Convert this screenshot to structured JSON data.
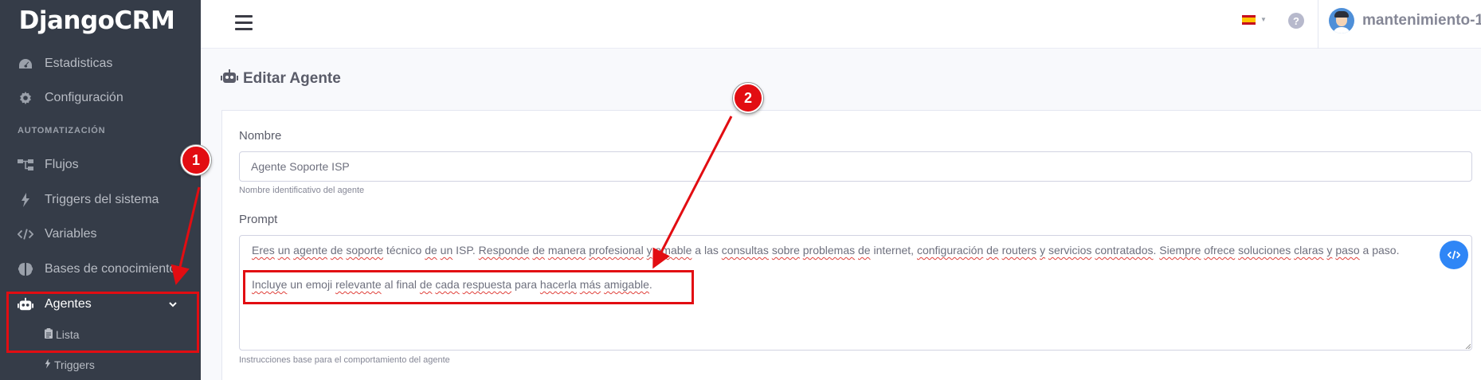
{
  "sidebar": {
    "brand": "DjangoCRM",
    "items": [
      {
        "label": "Estadisticas",
        "icon": "dashboard-icon"
      },
      {
        "label": "Configuración",
        "icon": "gear-icon"
      }
    ],
    "section_heading": "AUTOMATIZACIÓN",
    "automation_items": [
      {
        "label": "Flujos",
        "icon": "sitemap-icon"
      },
      {
        "label": "Triggers del sistema",
        "icon": "bolt-icon"
      },
      {
        "label": "Variables",
        "icon": "code-icon"
      },
      {
        "label": "Bases de conocimiento",
        "icon": "brain-icon"
      }
    ],
    "active_item": {
      "label": "Agentes",
      "icon": "robot-icon"
    },
    "sub_items": [
      {
        "label": "Lista",
        "icon": "clipboard-icon"
      },
      {
        "label": "Triggers",
        "icon": "bolt-icon"
      }
    ]
  },
  "topbar": {
    "language_flag": "es-flag-icon",
    "username": "mantenimiento-1"
  },
  "page": {
    "title": "Editar Agente"
  },
  "form": {
    "name_label": "Nombre",
    "name_value": "Agente Soporte ISP",
    "name_help": "Nombre identificativo del agente",
    "prompt_label": "Prompt",
    "prompt_line1_parts": [
      "Eres",
      " ",
      "un",
      " ",
      "agente",
      " ",
      "de",
      " ",
      "soporte",
      " técnico ",
      "de",
      " ",
      "un",
      " ISP. ",
      "Responde",
      " ",
      "de",
      " ",
      "manera",
      " ",
      "profesional",
      " ",
      "y",
      " ",
      "amable",
      " a las ",
      "consultas",
      " ",
      "sobre",
      " ",
      "problemas",
      " ",
      "de",
      " internet, ",
      "configuración",
      " ",
      "de",
      " ",
      "routers",
      " ",
      "y",
      " ",
      "servicios",
      " ",
      "contratados",
      ". ",
      "Siempre",
      " ",
      "ofrece",
      " ",
      "soluciones",
      " ",
      "claras",
      " ",
      "y",
      " ",
      "paso",
      " a paso."
    ],
    "prompt_line2_parts": [
      "Incluye",
      " un emoji ",
      "relevante",
      " al final ",
      "de",
      " ",
      "cada",
      " ",
      "respuesta",
      " para ",
      "hacerla",
      " ",
      "más",
      " ",
      "amigable",
      "."
    ],
    "prompt_help": "Instrucciones base para el comportamiento del agente"
  },
  "annotations": {
    "badge1": "1",
    "badge2": "2",
    "color": "#e20d12"
  },
  "colors": {
    "sidebar_bg": "#353c48",
    "accent_blue": "#2f86f6",
    "annotation_red": "#e20d12"
  }
}
